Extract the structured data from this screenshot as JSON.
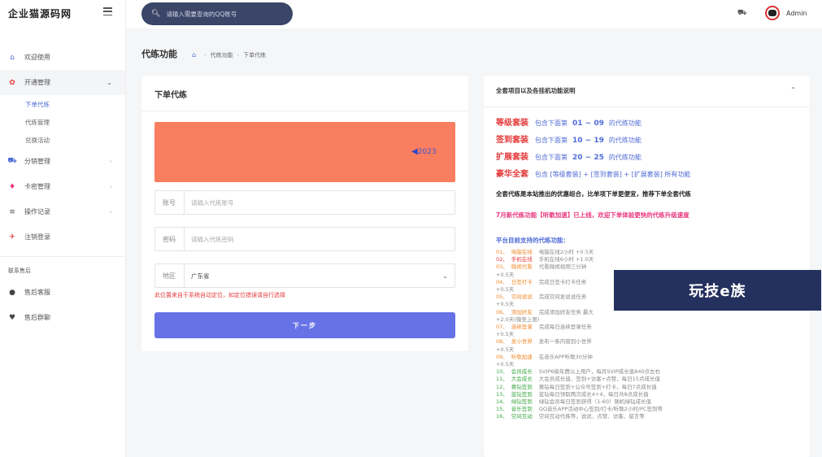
{
  "brand": {
    "title": "企业猫源码网"
  },
  "sidebar": {
    "items": [
      {
        "label": "欢迎使用",
        "icon": "home-icon",
        "glyph": "⌂",
        "color": "#4f6bd6"
      },
      {
        "label": "开通管理",
        "icon": "flame-icon",
        "glyph": "✿",
        "color": "#e33a3a"
      },
      {
        "label": "分销管理",
        "icon": "cart-icon",
        "glyph": "⛟",
        "color": "#4f6bd6"
      },
      {
        "label": "卡密管理",
        "icon": "diamond-icon",
        "glyph": "♦",
        "color": "#e8357c"
      },
      {
        "label": "操作记录",
        "icon": "list-icon",
        "glyph": "≡",
        "color": "#555555"
      },
      {
        "label": "注销登录",
        "icon": "logout-icon",
        "glyph": "✈",
        "color": "#e33a3a"
      }
    ],
    "sub_items": [
      "下单代练",
      "代练管理",
      "兑换活动"
    ],
    "section_title": "联系售后",
    "contact_items": [
      {
        "label": "售后客服",
        "icon": "github-icon",
        "glyph": "●"
      },
      {
        "label": "售后群聊",
        "icon": "heart-icon",
        "glyph": "♥"
      }
    ]
  },
  "topbar": {
    "search_placeholder": "请输入需要查询的QQ账号",
    "user": "Admin"
  },
  "page": {
    "title": "代练功能",
    "breadcrumb": [
      "代练功能",
      "下单代练"
    ]
  },
  "order_card": {
    "title": "下单代练",
    "banner_text": "2023",
    "account_label": "账号",
    "account_placeholder": "请输入代练账号",
    "password_label": "密码",
    "password_placeholder": "请输入代练密码",
    "region_label": "地区",
    "region_value": "广东省",
    "hint": "此位置来自于系统自动定位，如定位错误请自行选择",
    "next_label": "下一步"
  },
  "info_card": {
    "title": "全套项目以及各挂机功能说明",
    "packages": [
      {
        "name": "等级套装",
        "pre": "包含下面第",
        "range": "01 ~ 09",
        "post": "的代练功能"
      },
      {
        "name": "签到套装",
        "pre": "包含下面第",
        "range": "10 ~ 19",
        "post": "的代练功能"
      },
      {
        "name": "扩展套装",
        "pre": "包含下面第",
        "range": "20 ~ 25",
        "post": "的代练功能"
      },
      {
        "name": "豪华全套",
        "pre": "包含 [等级套装] + [签到套装] + [扩展套装] 所有功能",
        "range": "",
        "post": ""
      }
    ],
    "note1": "全套代练是本站推出的优惠组合，比单项下单更便宜，推荐下单全套代练",
    "note2": "7月新代练功能【听歌加速】已上线，欢迎下单体验更快的代练升级速度",
    "features_title": "平台目前支持的代练功能：",
    "features": [
      {
        "idx": "01、",
        "name": "电脑在线",
        "desc": "电脑在线2小时 +0.5天",
        "color": "#f08a2c"
      },
      {
        "idx": "02、",
        "name": "手机在线",
        "desc": "手机在线6小时 +1.0天",
        "color": "#e33a3a"
      },
      {
        "idx": "03、",
        "name": "微视代看",
        "desc": "代看微视视频三分钟",
        "color": "#f08a2c"
      },
      {
        "idx": "",
        "name": "",
        "desc": "+0.5天",
        "color": "#888888"
      },
      {
        "idx": "04、",
        "name": "日签打卡",
        "desc": "完成日签卡打卡任务",
        "color": "#f08a2c"
      },
      {
        "idx": "",
        "name": "",
        "desc": "+0.5天",
        "color": "#888888"
      },
      {
        "idx": "05、",
        "name": "空间说说",
        "desc": "完成空间发说说任务",
        "color": "#f08a2c"
      },
      {
        "idx": "",
        "name": "",
        "desc": "+0.5天",
        "color": "#888888"
      },
      {
        "idx": "06、",
        "name": "添加好友",
        "desc": "完成添加好友任务 最大",
        "color": "#f08a2c"
      },
      {
        "idx": "",
        "name": "",
        "desc": "+2.0天(微至上限)",
        "color": "#888888"
      },
      {
        "idx": "07、",
        "name": "连续登录",
        "desc": "完成每日连续登录任务",
        "color": "#f08a2c"
      },
      {
        "idx": "",
        "name": "",
        "desc": "+0.5天",
        "color": "#888888"
      },
      {
        "idx": "08、",
        "name": "发小世界",
        "desc": "发布一条内容到小世界",
        "color": "#f08a2c"
      },
      {
        "idx": "",
        "name": "",
        "desc": "+0.5天",
        "color": "#888888"
      },
      {
        "idx": "09、",
        "name": "听歌加速",
        "desc": "在音乐APP听歌30分钟",
        "color": "#f08a2c"
      },
      {
        "idx": "",
        "name": "",
        "desc": "+0.5天",
        "color": "#888888"
      },
      {
        "idx": "10、",
        "name": "会员成长",
        "desc": "SVIP6级年费以上用户，每月SVIP成长值840点左右",
        "color": "#3aa843"
      },
      {
        "idx": "11、",
        "name": "大会成长",
        "desc": "大会员成长值、签到+访客+点赞，每日15点成长值",
        "color": "#3aa843"
      },
      {
        "idx": "12、",
        "name": "黄钻签到",
        "desc": "黄钻每日签到+公众号签到+打卡，每日7点成长值",
        "color": "#3aa843"
      },
      {
        "idx": "13、",
        "name": "蓝钻签到",
        "desc": "蓝钻每日领取两次成长4+4，每日共8点成长值",
        "color": "#3aa843"
      },
      {
        "idx": "14、",
        "name": "绿钻签到",
        "desc": "绿钻会员每日签到获得（1-60）随机绿钻成长值",
        "color": "#3aa843"
      },
      {
        "idx": "15、",
        "name": "音乐签到",
        "desc": "QQ音乐APP活动中心签到/打卡/听歌2小时/PC签到等",
        "color": "#3aa843"
      },
      {
        "idx": "16、",
        "name": "空间互动",
        "desc": "空间互动代练等，说说、点赞、访客、留言等",
        "color": "#3aa843"
      }
    ]
  },
  "watermark": {
    "text": "玩技e族"
  },
  "colors": {
    "accent": "#4f6bd6",
    "banner": "#f97d5f",
    "button": "#6672e6",
    "danger": "#e33a3a"
  }
}
